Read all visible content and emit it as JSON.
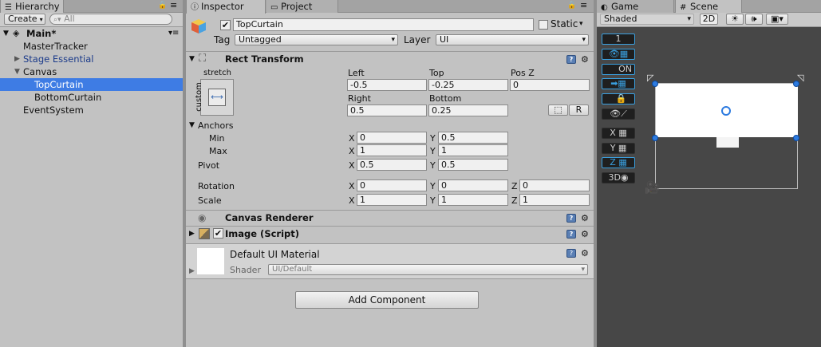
{
  "hierarchy": {
    "tab_label": "Hierarchy",
    "create_label": "Create",
    "search_placeholder": "All",
    "scene_name": "Main*",
    "items": [
      {
        "label": "MasterTracker"
      },
      {
        "label": "Stage Essential"
      },
      {
        "label": "Canvas"
      },
      {
        "label": "TopCurtain"
      },
      {
        "label": "BottomCurtain"
      },
      {
        "label": "EventSystem"
      }
    ]
  },
  "inspector": {
    "tabs": [
      {
        "label": "Inspector"
      },
      {
        "label": "Project"
      }
    ],
    "object_name": "TopCurtain",
    "static_label": "Static",
    "tag_label": "Tag",
    "tag_value": "Untagged",
    "layer_label": "Layer",
    "layer_value": "UI",
    "rect_transform": {
      "title": "Rect Transform",
      "anchor_preset_top": "stretch",
      "anchor_preset_side": "custom",
      "left_label": "Left",
      "left_value": "-0.5",
      "top_label": "Top",
      "top_value": "-0.25",
      "posz_label": "Pos Z",
      "posz_value": "0",
      "right_label": "Right",
      "right_value": "0.5",
      "bottom_label": "Bottom",
      "bottom_value": "0.25",
      "raw_button": "R",
      "anchors_label": "Anchors",
      "min_label": "Min",
      "min_x": "0",
      "min_y": "0.5",
      "max_label": "Max",
      "max_x": "1",
      "max_y": "1",
      "pivot_label": "Pivot",
      "pivot_x": "0.5",
      "pivot_y": "0.5",
      "rotation_label": "Rotation",
      "rot_x": "0",
      "rot_y": "0",
      "rot_z": "0",
      "scale_label": "Scale",
      "scale_x": "1",
      "scale_y": "1",
      "scale_z": "1",
      "axis_x": "X",
      "axis_y": "Y",
      "axis_z": "Z"
    },
    "canvas_renderer_title": "Canvas Renderer",
    "image_title": "Image (Script)",
    "material_name": "Default UI Material",
    "shader_label": "Shader",
    "shader_value": "UI/Default",
    "add_component_label": "Add Component"
  },
  "scene": {
    "tabs": [
      {
        "label": "Game"
      },
      {
        "label": "Scene"
      }
    ],
    "shading_mode": "Shaded",
    "mode_2d": "2D",
    "tools": [
      {
        "label": "1"
      },
      {
        "label": ""
      },
      {
        "label": "ON"
      },
      {
        "label": ""
      },
      {
        "label": ""
      },
      {
        "label": ""
      },
      {
        "label": "X"
      },
      {
        "label": "Y"
      },
      {
        "label": "Z"
      },
      {
        "label": "3D"
      }
    ]
  },
  "colors": {
    "selection": "#3e7ce4",
    "scene_bg": "#474747",
    "handle": "#2d7be0"
  }
}
